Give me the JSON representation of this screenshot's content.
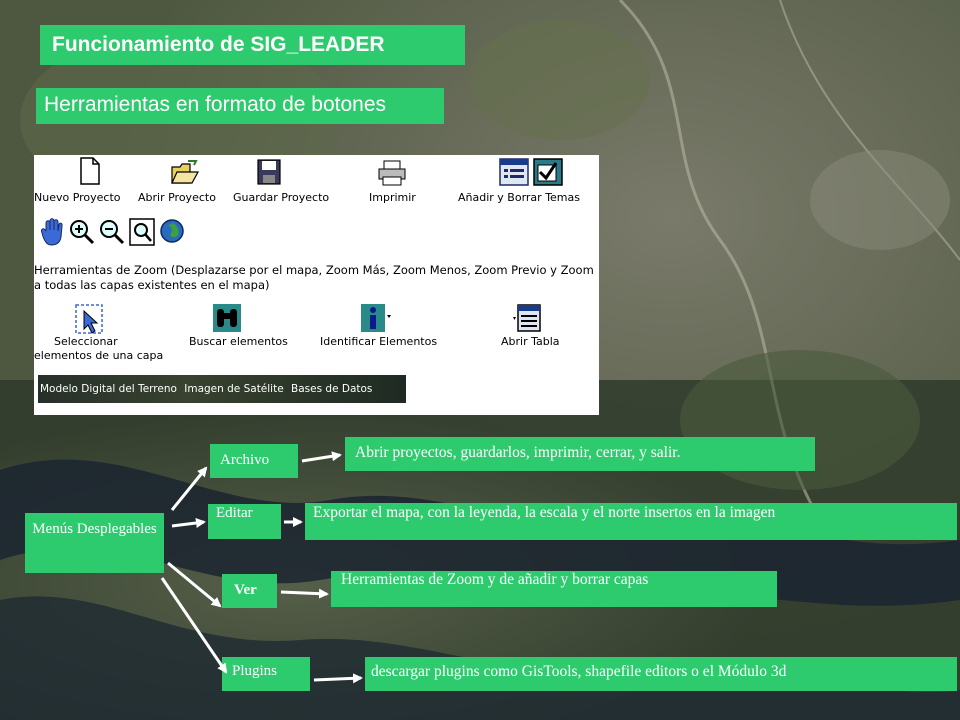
{
  "slide": {
    "title": "Funcionamiento de SIG_LEADER",
    "subtitle": "Herramientas en formato de botones"
  },
  "toolbar": {
    "row1": [
      {
        "label": "Nuevo Proyecto",
        "icon": "new-file-icon"
      },
      {
        "label": "Abrir Proyecto",
        "icon": "open-folder-icon"
      },
      {
        "label": "Guardar Proyecto",
        "icon": "floppy-disk-icon"
      },
      {
        "label": "Imprimir",
        "icon": "printer-icon"
      },
      {
        "label": "Añadir y Borrar Temas",
        "icon": "add-remove-themes-icon"
      }
    ],
    "zoom_icons": [
      "pan-hand-icon",
      "zoom-in-icon",
      "zoom-out-icon",
      "zoom-previous-icon",
      "zoom-extent-globe-icon"
    ],
    "zoom_description": "Herramientas de Zoom (Desplazarse por el mapa, Zoom Más, Zoom Menos, Zoom Previo y Zoom a todas las capas existentes en el mapa)",
    "row3": [
      {
        "label": "Seleccionar",
        "label2": "elementos de una capa",
        "icon": "select-arrow-icon"
      },
      {
        "label": "Buscar elementos",
        "icon": "binoculars-icon"
      },
      {
        "label": "Identificar Elementos",
        "icon": "info-icon"
      },
      {
        "label": "Abrir Tabla",
        "icon": "table-icon"
      }
    ],
    "layers": [
      "Modelo Digital del Terreno",
      "Imagen de Satélite",
      "Bases de Datos"
    ]
  },
  "menus": {
    "root": "Menús Desplegables",
    "items": [
      {
        "label": "Archivo",
        "description": "Abrir proyectos, guardarlos, imprimir, cerrar, y salir."
      },
      {
        "label": "Editar",
        "description": "Exportar el mapa, con la leyenda, la escala y el norte insertos en la imagen"
      },
      {
        "label": "Ver",
        "description": "Herramientas de Zoom  y de añadir y borrar capas"
      },
      {
        "label": "Plugins",
        "description": "descargar plugins como GisTools, shapefile editors o el Módulo 3d"
      }
    ]
  },
  "colors": {
    "box_green": "#2ecb6e",
    "arrow_white": "#ffffff"
  }
}
